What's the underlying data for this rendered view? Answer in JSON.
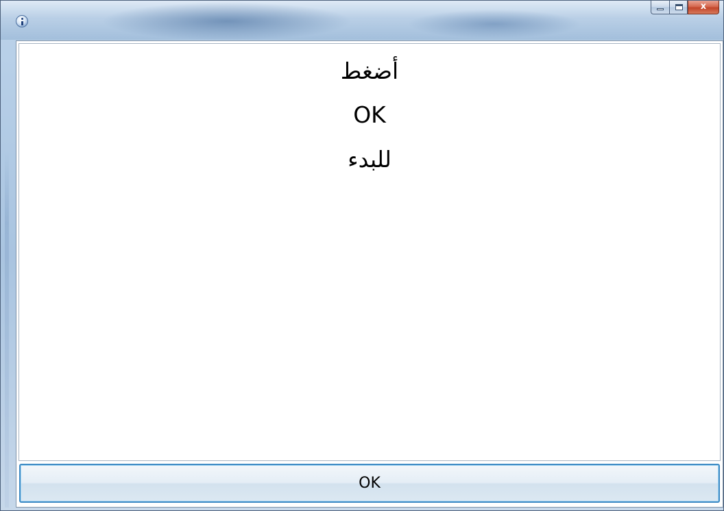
{
  "window": {
    "title": "",
    "icon": "info-icon",
    "caption": {
      "minimize_icon": "minimize-icon",
      "maximize_icon": "maximize-icon",
      "close_label": "x"
    }
  },
  "message": {
    "lines": [
      "أضغط",
      "OK",
      "للبدء"
    ]
  },
  "ok_button": {
    "label": "OK"
  },
  "colors": {
    "accent_border": "#3d8ac4",
    "close_button": "#c2452a",
    "titlebar": "#a3bfdc"
  }
}
